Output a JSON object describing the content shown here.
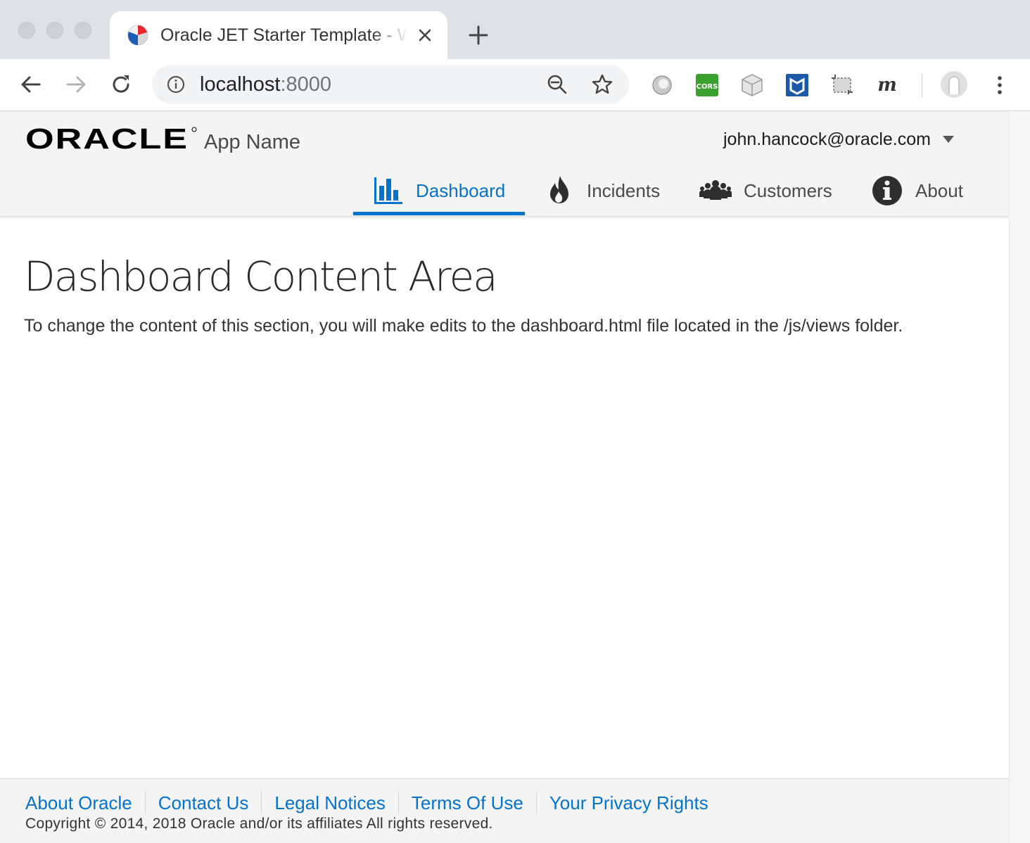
{
  "browser": {
    "tab": {
      "title": "Oracle JET Starter Template - Web Nav Bar",
      "close_icon": "close-icon",
      "favicon": "oracle-jet-favicon"
    },
    "new_tab_icon": "plus-icon",
    "url": {
      "host": "localhost",
      "port": ":8000"
    },
    "extensions": [
      "gray-circle-extension-icon",
      "cors-extension-icon",
      "cube-extension-icon",
      "mcafee-extension-icon",
      "screenshot-extension-icon",
      "m-extension-icon",
      "profile-avatar-icon",
      "menu-dots-icon"
    ],
    "extension_labels": {
      "cors": "CORS",
      "m": "m"
    }
  },
  "header": {
    "logo_text": "ORACLE",
    "app_name": "App Name",
    "user": "john.hancock@oracle.com"
  },
  "nav": {
    "items": [
      {
        "label": "Dashboard",
        "icon": "bar-chart-icon",
        "selected": true
      },
      {
        "label": "Incidents",
        "icon": "fire-icon",
        "selected": false
      },
      {
        "label": "Customers",
        "icon": "people-icon",
        "selected": false
      },
      {
        "label": "About",
        "icon": "info-icon",
        "selected": false
      }
    ]
  },
  "content": {
    "title": "Dashboard Content Area",
    "text": "To change the content of this section, you will make edits to the dashboard.html file located in the /js/views folder."
  },
  "footer": {
    "links": [
      "About Oracle",
      "Contact Us",
      "Legal Notices",
      "Terms Of Use",
      "Your Privacy Rights"
    ],
    "copyright": "Copyright © 2014, 2018 Oracle and/or its affiliates All rights reserved."
  },
  "colors": {
    "accent": "#0572ce",
    "header_bg": "#f4f4f4",
    "chrome_bg": "#dee1e6"
  }
}
